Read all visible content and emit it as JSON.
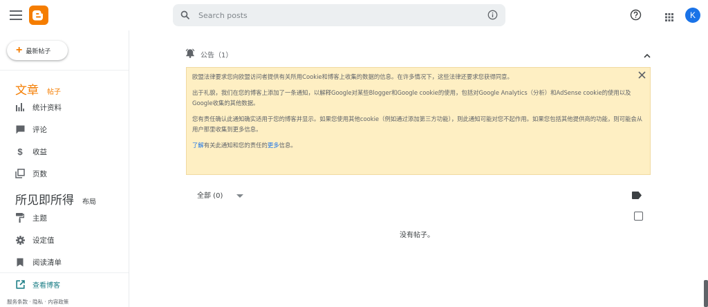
{
  "header": {
    "search_placeholder": "Search posts",
    "avatar_letter": "K",
    "brand_color": "#f57d00"
  },
  "sidebar": {
    "new_post": "最新帖子",
    "sections": {
      "posts_big": "文章",
      "posts_small": "帖子",
      "layout_big": "所见即所得",
      "layout_small": "布局"
    },
    "items": [
      {
        "label": "统计资料",
        "icon": "bar-chart-icon"
      },
      {
        "label": "评论",
        "icon": "comment-icon"
      },
      {
        "label": "收益",
        "icon": "dollar-icon"
      },
      {
        "label": "页数",
        "icon": "pages-icon"
      },
      {
        "label": "主题",
        "icon": "paint-roller-icon"
      },
      {
        "label": "设定值",
        "icon": "gear-icon"
      },
      {
        "label": "阅读清单",
        "icon": "bookmark-icon"
      }
    ],
    "view_blog": "查看博客",
    "footer": "服务条款 · 隐私 · 内容政策"
  },
  "main": {
    "notice_label": "公告（1）",
    "notice": {
      "p1": "欧盟法律要求您向欧盟访问者提供有关所用Cookie和博客上收集的数据的信息。在许多情况下，这些法律还要求您获得同意。",
      "p2": "出于礼貌，我们在您的博客上添加了一条通知，以解释Google对某些Blogger和Google cookie的使用，包括对Google Analytics（分析）和AdSense cookie的使用以及Google收集的其他数据。",
      "p3": "您有责任确认此通知确实适用于您的博客并显示。如果您使用其他cookie（例如通过添加第三方功能），则此通知可能对您不起作用。如果您包括其他提供商的功能，则可能会从用户那里收集到更多信息。",
      "p4_link1": "了解",
      "p4_mid": "有关此通知和您的责任的",
      "p4_link2": "更多",
      "p4_end": "信息。"
    },
    "filter_label": "全部 (0)",
    "empty_message": "没有帖子。"
  }
}
